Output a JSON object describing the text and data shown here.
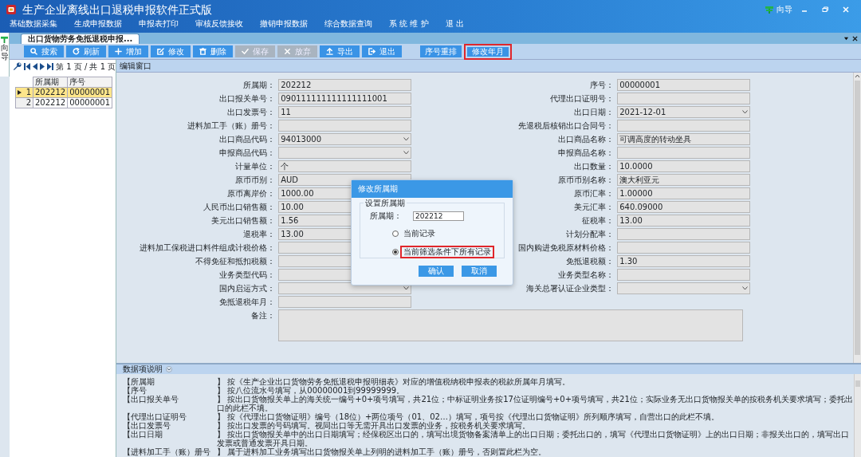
{
  "window": {
    "title": "生产企业离线出口退税申报软件正式版",
    "guide": "向导"
  },
  "menu": [
    {
      "label": "基础数据采集"
    },
    {
      "label": "生成申报数据"
    },
    {
      "label": "申报表打印"
    },
    {
      "label": "审核反馈接收"
    },
    {
      "label": "撤销申报数据"
    },
    {
      "label": "综合数据查询"
    },
    {
      "label": "系 统 维 护"
    },
    {
      "label": "退 出"
    }
  ],
  "side_tab": {
    "label": "向导"
  },
  "tabs": [
    {
      "label": "出口货物劳务免抵退税申报...",
      "selected": true
    }
  ],
  "toolbar": [
    {
      "label": "搜索",
      "kind": "search",
      "disabled": false,
      "highlighted": false
    },
    {
      "label": "刷新",
      "kind": "refresh",
      "disabled": false,
      "highlighted": false
    },
    {
      "label": "增加",
      "kind": "plus",
      "disabled": false,
      "highlighted": false
    },
    {
      "label": "修改",
      "kind": "edit",
      "disabled": false,
      "highlighted": false
    },
    {
      "label": "删除",
      "kind": "trash",
      "disabled": false,
      "highlighted": false
    },
    {
      "label": "保存",
      "kind": "check",
      "disabled": true,
      "highlighted": false
    },
    {
      "label": "放弃",
      "kind": "cross",
      "disabled": true,
      "highlighted": false
    },
    {
      "label": "导出",
      "kind": "upload",
      "disabled": false,
      "highlighted": false
    },
    {
      "label": "退出",
      "kind": "exit",
      "disabled": false,
      "highlighted": false
    },
    {
      "label": "序号重排",
      "kind": "plain",
      "disabled": false,
      "highlighted": false
    },
    {
      "label": "修改年月",
      "kind": "plain",
      "disabled": false,
      "highlighted": true
    }
  ],
  "pager": {
    "text": "第 1 页 / 共 1 页"
  },
  "grid": {
    "columns": [
      "所属期",
      "序号"
    ],
    "rows": [
      {
        "number": "1",
        "cells": [
          "202212",
          "00000001"
        ],
        "selected": true
      },
      {
        "number": "2",
        "cells": [
          "202212",
          "00000001"
        ],
        "selected": false
      }
    ]
  },
  "editor": {
    "title": "编辑窗口",
    "left": [
      {
        "label": "所属期：",
        "value": "202212",
        "kind": "text"
      },
      {
        "label": "出口报关单号：",
        "value": "090111111111111111001",
        "kind": "text"
      },
      {
        "label": "出口发票号：",
        "value": "11",
        "kind": "text"
      },
      {
        "label": "进料加工手（账）册号：",
        "kind": "text"
      },
      {
        "label": "出口商品代码：",
        "value": "94013000",
        "kind": "select"
      },
      {
        "label": "申报商品代码：",
        "kind": "select"
      },
      {
        "label": "计量单位：",
        "value": "个",
        "kind": "text"
      },
      {
        "label": "原币币别：",
        "value": "AUD",
        "kind": "text"
      },
      {
        "label": "原币离岸价：",
        "value": "1000.00",
        "kind": "text"
      },
      {
        "label": "人民币出口销售额：",
        "value": "10.00",
        "kind": "text"
      },
      {
        "label": "美元出口销售额：",
        "value": "1.56",
        "kind": "text"
      },
      {
        "label": "退税率：",
        "value": "13.00",
        "kind": "text"
      },
      {
        "label": "进料加工保税进口料件组成计税价格：",
        "kind": "text"
      },
      {
        "label": "不得免征和抵扣税额：",
        "kind": "text"
      },
      {
        "label": "业务类型代码：",
        "kind": "select"
      },
      {
        "label": "国内启运方式：",
        "kind": "select"
      },
      {
        "label": "免抵退税年月：",
        "kind": "text"
      }
    ],
    "right": [
      {
        "label": "序号：",
        "value": "00000001",
        "kind": "text"
      },
      {
        "label": "代理出口证明号：",
        "kind": "text"
      },
      {
        "label": "出口日期：",
        "value": "2021-12-01",
        "kind": "select"
      },
      {
        "label": "先退税后核销出口合同号：",
        "kind": "text"
      },
      {
        "label": "出口商品名称：",
        "value": "可调高度的转动坐具",
        "kind": "text"
      },
      {
        "label": "申报商品名称：",
        "kind": "text"
      },
      {
        "label": "出口数量：",
        "value": "10.0000",
        "kind": "text"
      },
      {
        "label": "原币币别名称：",
        "value": "澳大利亚元",
        "kind": "text"
      },
      {
        "label": "原币汇率：",
        "value": "1.00000",
        "kind": "text"
      },
      {
        "label": "美元汇率：",
        "value": "640.09000",
        "kind": "text"
      },
      {
        "label": "征税率：",
        "value": "13.00",
        "kind": "text"
      },
      {
        "label": "计划分配率：",
        "kind": "text"
      },
      {
        "label": "国内购进免税原材料价格：",
        "kind": "text"
      },
      {
        "label": "免抵退税额：",
        "value": "1.30",
        "kind": "text"
      },
      {
        "label": "业务类型名称：",
        "kind": "text"
      },
      {
        "label": "海关总署认证企业类型：",
        "kind": "select"
      }
    ],
    "remarks": {
      "label": "备注："
    }
  },
  "help": {
    "title": "数据项说明",
    "items": [
      {
        "key": "【所属期",
        "text": "】 按《生产企业出口货物劳务免抵退税申报明细表》对应的增值税纳税申报表的税款所属年月填写。"
      },
      {
        "key": "【序号",
        "text": "】 按八位流水号填写，从00000001到99999999。"
      },
      {
        "key": "【出口报关单号",
        "text": "】 按出口货物报关单上的海关统一编号+0+项号填写，共21位；中标证明业务按17位证明编号+0+项号填写，共21位；实际业务无出口货物报关单的按税务机关要求填写；委托出口的此栏不填。"
      },
      {
        "key": "【代理出口证明号",
        "text": "】 按《代理出口货物证明》编号（18位）+两位项号（01、02…）填写，项号按《代理出口货物证明》所列顺序填写，自营出口的此栏不填。"
      },
      {
        "key": "【出口发票号",
        "text": "】 按出口发票的号码填写。视同出口等无需开具出口发票的业务，按税务机关要求填写。"
      },
      {
        "key": "【出口日期",
        "text": "】 按出口货物报关单中的出口日期填写；经保税区出口的，填写出境货物备案清单上的出口日期；委托出口的，填写《代理出口货物证明》上的出口日期；非报关出口的，填写出口发票或普通发票开具日期。"
      },
      {
        "key": "【进料加工手（账）册号",
        "text": "】 属于进料加工业务填写出口货物报关单上列明的进料加工手（账）册号，否则置此栏为空。"
      }
    ]
  },
  "dialog": {
    "title": "修改所属期",
    "group": "设置所属期",
    "field_label": "所属期：",
    "value": "202212",
    "options": [
      {
        "label": "当前记录",
        "selected": false,
        "highlighted": false
      },
      {
        "label": "当前筛选条件下所有记录",
        "selected": true,
        "highlighted": true
      }
    ],
    "buttons": [
      {
        "label": "确认"
      },
      {
        "label": "取消"
      }
    ]
  }
}
